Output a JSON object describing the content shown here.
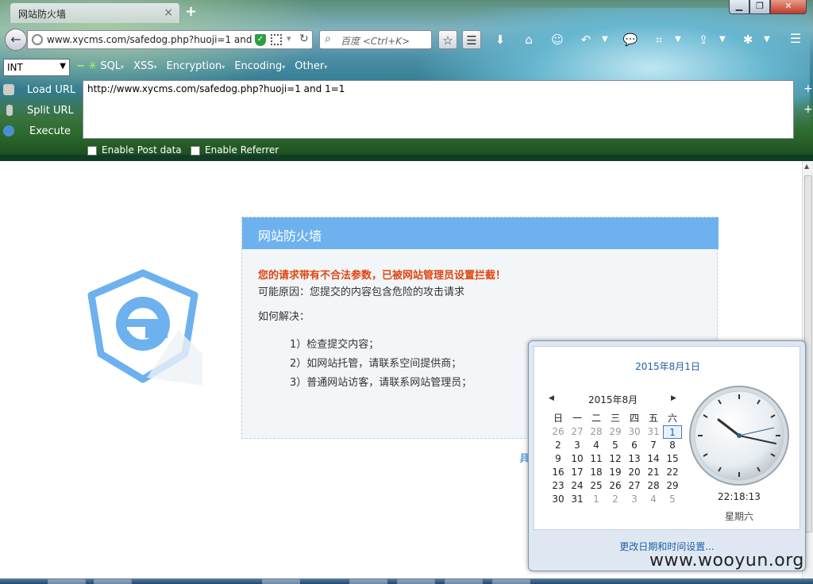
{
  "browser": {
    "tab_title": "网站防火墙",
    "tab_close": "×",
    "new_tab": "+",
    "url": "www.xycms.com/safedog.php?huoji=1 and",
    "search_placeholder": "百度 <Ctrl+K>",
    "window_buttons": {
      "minimize": "▁",
      "maximize": "❐",
      "close": "✕"
    }
  },
  "hackbar": {
    "type_select": "INT",
    "menu": [
      "SQL",
      "XSS",
      "Encryption",
      "Encoding",
      "Other"
    ],
    "load_url": "Load URL",
    "split_url": "Split URL",
    "execute": "Execute",
    "url_text": "http://www.xycms.com/safedog.php?huoji=1 and 1=1",
    "enable_post": "Enable Post data",
    "enable_referrer": "Enable Referrer"
  },
  "firewall": {
    "header": "网站防火墙",
    "warning": "您的请求带有不合法参数，已被网站管理员设置拦截！",
    "reason": "可能原因：您提交的内容包含危险的攻击请求",
    "how": "如何解决：",
    "steps": [
      "1）检查提交内容；",
      "2）如网站托管，请联系空间提供商；",
      "3）普通网站访客，请联系网站管理员；"
    ],
    "link_partial": "具"
  },
  "calendar": {
    "full_date": "2015年8月1日",
    "month_label": "2015年8月",
    "weekday_headers": [
      "日",
      "一",
      "二",
      "三",
      "四",
      "五",
      "六"
    ],
    "weeks": [
      [
        "26",
        "27",
        "28",
        "29",
        "30",
        "31",
        "1"
      ],
      [
        "2",
        "3",
        "4",
        "5",
        "6",
        "7",
        "8"
      ],
      [
        "9",
        "10",
        "11",
        "12",
        "13",
        "14",
        "15"
      ],
      [
        "16",
        "17",
        "18",
        "19",
        "20",
        "21",
        "22"
      ],
      [
        "23",
        "24",
        "25",
        "26",
        "27",
        "28",
        "29"
      ],
      [
        "30",
        "31",
        "1",
        "2",
        "3",
        "4",
        "5"
      ]
    ],
    "time": "22:18:13",
    "weekday": "星期六",
    "footer_link": "更改日期和时间设置..."
  },
  "watermark": "www.wooyun.org",
  "colors": {
    "header_blue": "#6db1ef",
    "warning_orange": "#e1450f",
    "link_blue": "#1e5fa8"
  }
}
